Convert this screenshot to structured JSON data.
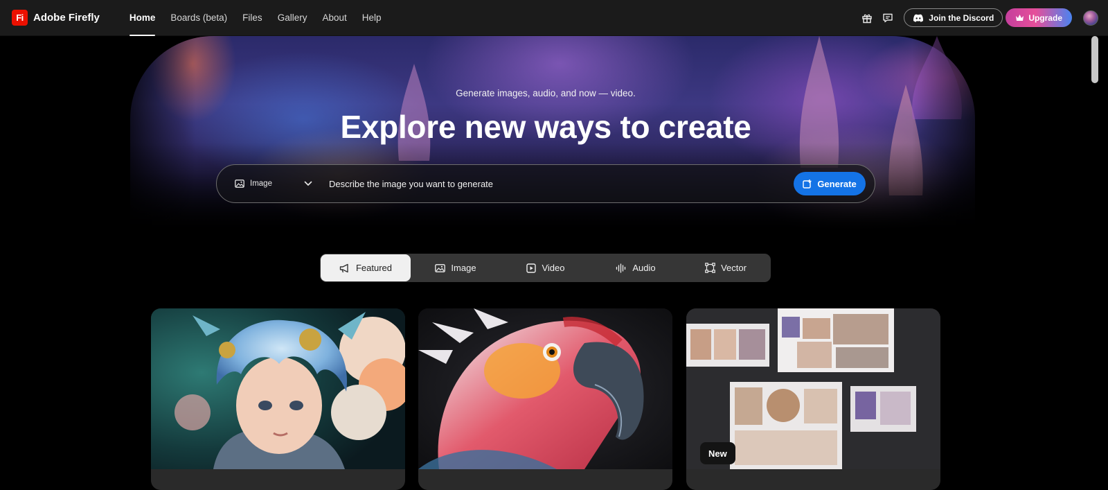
{
  "app": {
    "brand_mark": "Fi",
    "brand_name": "Adobe Firefly"
  },
  "nav": {
    "items": [
      {
        "label": "Home",
        "active": true
      },
      {
        "label": "Boards (beta)",
        "active": false
      },
      {
        "label": "Files",
        "active": false
      },
      {
        "label": "Gallery",
        "active": false
      },
      {
        "label": "About",
        "active": false
      },
      {
        "label": "Help",
        "active": false
      }
    ]
  },
  "topbar": {
    "gift_icon": "gift-icon",
    "feedback_icon": "chat-bubble-icon",
    "discord_label": "Join the Discord",
    "upgrade_label": "Upgrade"
  },
  "hero": {
    "subtitle": "Generate images, audio, and now — video.",
    "title": "Explore new ways to create"
  },
  "prompt": {
    "type_label": "Image",
    "placeholder": "Describe the image you want to generate",
    "generate_label": "Generate"
  },
  "tabs": [
    {
      "label": "Featured",
      "icon": "megaphone-icon",
      "active": true
    },
    {
      "label": "Image",
      "icon": "image-icon",
      "active": false
    },
    {
      "label": "Video",
      "icon": "video-icon",
      "active": false
    },
    {
      "label": "Audio",
      "icon": "audio-wave-icon",
      "active": false
    },
    {
      "label": "Vector",
      "icon": "vector-icon",
      "active": false
    }
  ],
  "cards": [
    {
      "subject": "Blue-haired child with floral headdress"
    },
    {
      "subject": "Red and white parrot portrait"
    },
    {
      "subject": "Mood board collage of product photos",
      "badge": "New"
    }
  ],
  "colors": {
    "accent_blue": "#1473e6",
    "topbar_bg": "#1b1b1b",
    "brand_red": "#eb1000"
  }
}
